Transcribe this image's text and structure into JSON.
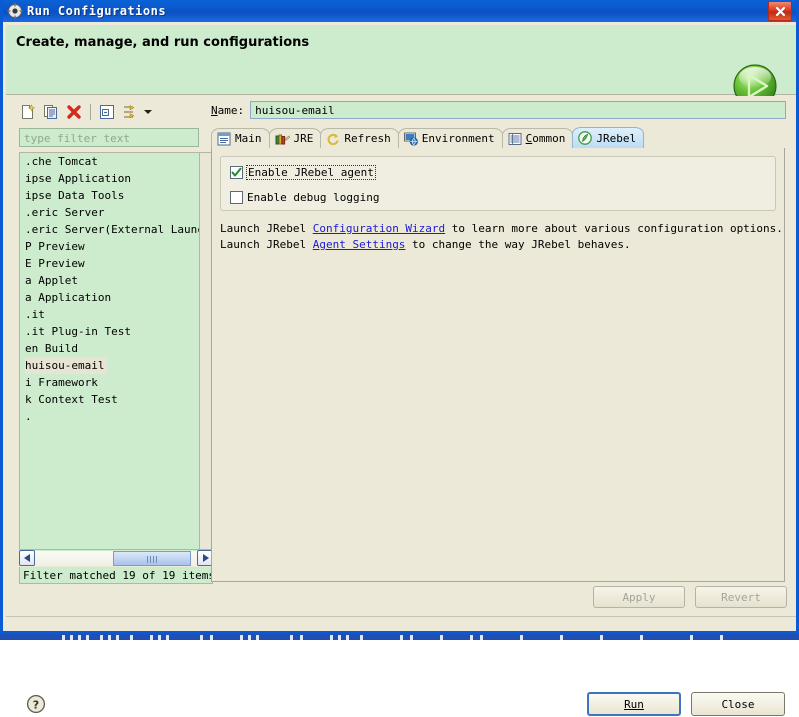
{
  "window": {
    "title": "Run Configurations",
    "title_icon": "run-config-icon",
    "close_label": "x"
  },
  "header": {
    "title": "Create, manage, and run configurations",
    "icon": "green-run-play-icon"
  },
  "left_panel": {
    "toolbar": [
      {
        "name": "new-configuration-button",
        "icon": "new-document-icon"
      },
      {
        "name": "duplicate-configuration-button",
        "icon": "copy-document-icon"
      },
      {
        "name": "delete-configuration-button",
        "icon": "red-x-delete-icon"
      },
      {
        "name": "collapse-all-button",
        "icon": "collapse-all-icon"
      },
      {
        "name": "filter-configurations-button",
        "icon": "filter-arrows-icon"
      }
    ],
    "filter": {
      "value": "",
      "placeholder": "type filter text"
    },
    "items": [
      {
        "label": ".che Tomcat",
        "selected": false
      },
      {
        "label": "ipse Application",
        "selected": false
      },
      {
        "label": "ipse Data Tools",
        "selected": false
      },
      {
        "label": ".eric Server",
        "selected": false
      },
      {
        "label": ".eric Server(External Launch)",
        "selected": false
      },
      {
        "label": "P Preview",
        "selected": false
      },
      {
        "label": "E Preview",
        "selected": false
      },
      {
        "label": "a Applet",
        "selected": false
      },
      {
        "label": "a Application",
        "selected": false
      },
      {
        "label": ".it",
        "selected": false
      },
      {
        "label": ".it Plug-in Test",
        "selected": false
      },
      {
        "label": "en Build",
        "selected": false
      },
      {
        "label": "huisou-email",
        "selected": true
      },
      {
        "label": "i Framework",
        "selected": false
      },
      {
        "label": "k Context Test",
        "selected": false
      },
      {
        "label": ".",
        "selected": false
      }
    ],
    "status": "Filter matched 19 of 19 items"
  },
  "right_panel": {
    "name_label_prefix": "N",
    "name_label_rest": "ame:",
    "name_value": "huisou-email",
    "name_placeholder": "",
    "tabs": [
      {
        "label": "Main",
        "icon": "main-tab-icon",
        "active": false
      },
      {
        "label": "JRE",
        "icon": "jre-books-icon",
        "active": false
      },
      {
        "label": "Refresh",
        "icon": "refresh-arrows-icon",
        "active": false
      },
      {
        "label": "Environment",
        "icon": "environment-icon",
        "active": false
      },
      {
        "label": "Common",
        "icon": "common-list-icon",
        "active": false
      },
      {
        "label": "JRebel",
        "icon": "jrebel-icon",
        "active": true
      }
    ],
    "checkboxes": [
      {
        "label": "Enable JRebel agent",
        "checked": true,
        "focused": true
      },
      {
        "label": "Enable debug logging",
        "checked": false,
        "focused": false
      }
    ],
    "info_line_1": {
      "pre": "Launch JRebel ",
      "link": "Configuration Wizard",
      "post": " to learn more about various configuration options."
    },
    "info_line_2": {
      "pre": "Launch JRebel ",
      "link": "Agent Settings",
      "post": " to change the way JRebel behaves."
    }
  },
  "buttons": {
    "apply": "Apply",
    "revert": "Revert",
    "run": "Run",
    "close": "Close",
    "help": "?"
  },
  "colors": {
    "titlebar_blue": "#0a56c8",
    "header_green": "#cdebcd",
    "panel_cream": "#ece9d8",
    "list_green": "#cdebcd",
    "selected_item": "#e8e4d4",
    "link_blue": "#1b1bd0",
    "active_tab": "#bcdcf4",
    "close_red": "#de3a20"
  }
}
